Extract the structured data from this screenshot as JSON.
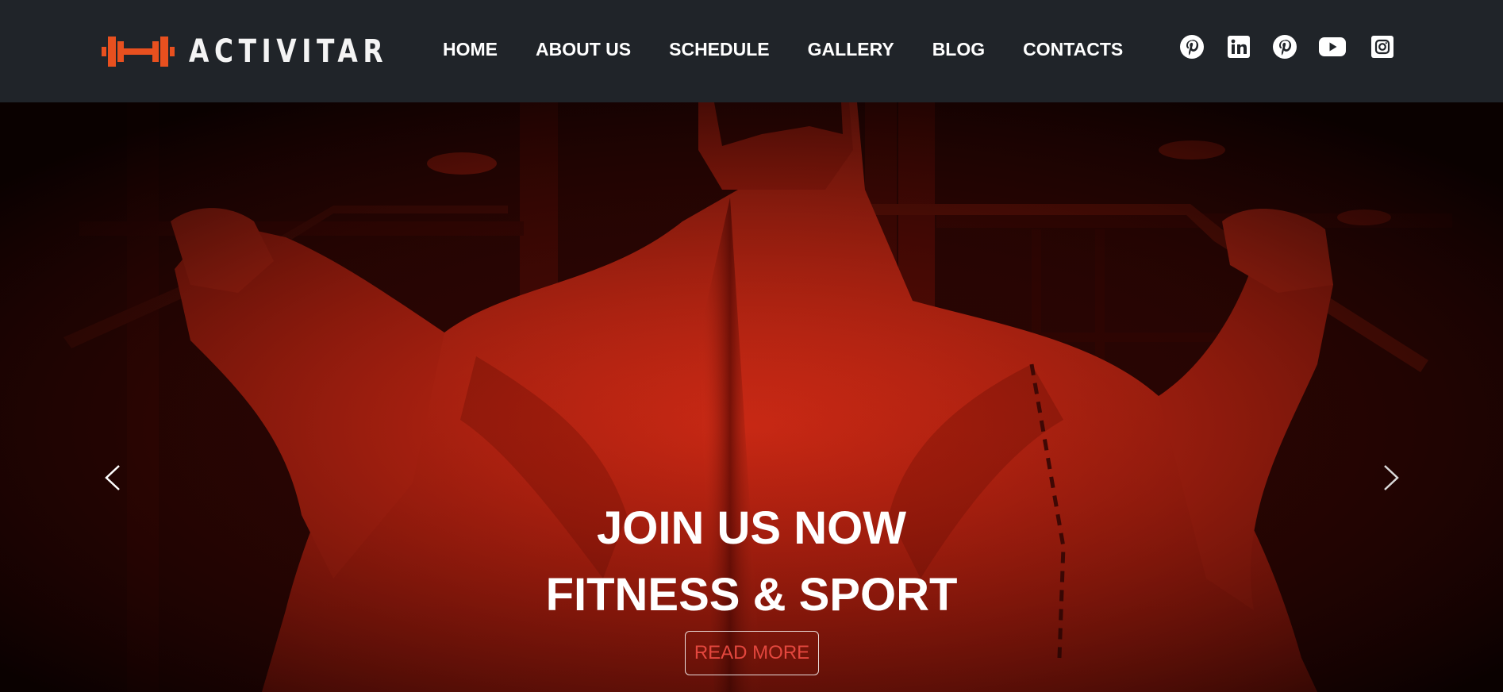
{
  "brand": {
    "name": "ACTIVITAR",
    "accent": "#e8501f"
  },
  "nav": {
    "items": [
      {
        "label": "HOME"
      },
      {
        "label": "ABOUT US"
      },
      {
        "label": "SCHEDULE"
      },
      {
        "label": "GALLERY"
      },
      {
        "label": "BLOG"
      },
      {
        "label": "CONTACTS"
      }
    ]
  },
  "social": [
    "pinterest-icon",
    "linkedin-icon",
    "pinterest-icon",
    "youtube-icon",
    "instagram-icon"
  ],
  "hero": {
    "line1": "JOIN US NOW",
    "line2": "FITNESS & SPORT",
    "cta": "READ MORE",
    "tint": "#d42a14"
  }
}
